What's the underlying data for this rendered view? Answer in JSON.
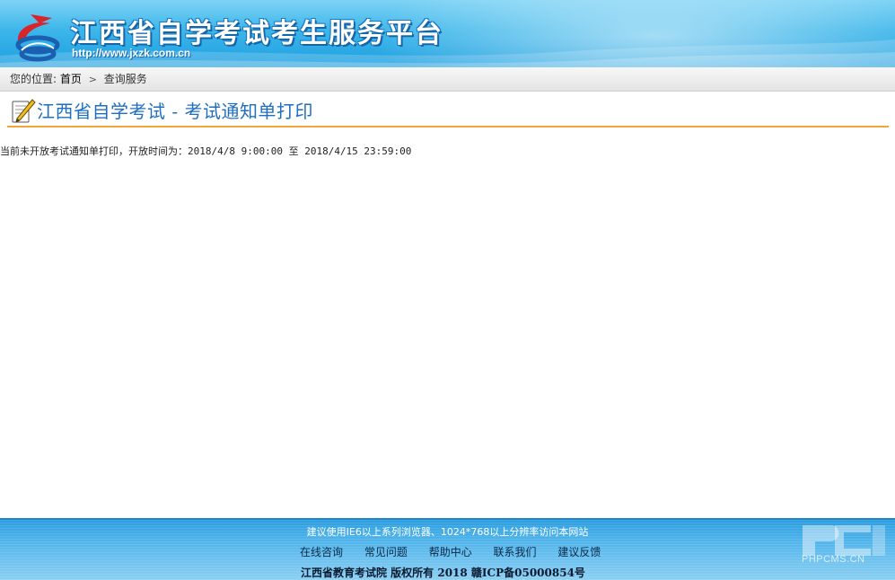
{
  "header": {
    "site_title": "江西省自学考试考生服务平台",
    "site_url": "http://www.jxzk.com.cn",
    "logo_icon": "jxzk-logo-icon"
  },
  "breadcrumb": {
    "prefix": "您的位置:",
    "home": "首页",
    "separator": ">",
    "current": "查询服务"
  },
  "page": {
    "heading": "江西省自学考试 - 考试通知单打印",
    "heading_icon": "pencil-notepad-icon",
    "notice": "当前未开放考试通知单打印，开放时间为：2018/4/8 9:00:00 至 2018/4/15 23:59:00"
  },
  "footer": {
    "recommend": "建议使用IE6以上系列浏览器、1024*768以上分辨率访问本网站",
    "links": [
      "在线咨询",
      "常见问题",
      "帮助中心",
      "联系我们",
      "建议反馈"
    ],
    "copyright": "江西省教育考试院 版权所有 2018 赣ICP备05000854号",
    "watermark": "PHPCMS.CN"
  },
  "colors": {
    "header_blue": "#3cb6ea",
    "heading_blue": "#1f6fc0",
    "heading_rule": "#f2a53a",
    "footer_blue": "#57b7ec"
  }
}
